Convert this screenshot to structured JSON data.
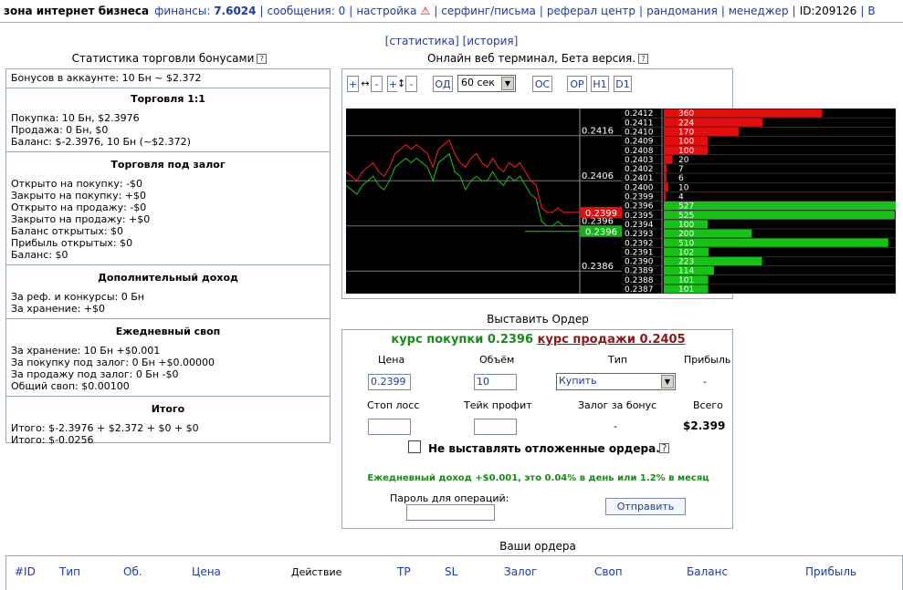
{
  "topbar": {
    "brand": "зона интернет бизнеса",
    "finance_label": "финансы:",
    "finance_value": "7.6024",
    "messages": "сообщения: 0",
    "settings": "настройка",
    "surfing": "серфинг/письма",
    "referral": "реферал центр",
    "randomania": "рандомания",
    "manager": "менеджер",
    "user_id": "ID:209126",
    "extra": "В"
  },
  "top_links": {
    "stats": "[статистика]",
    "history": "[история]"
  },
  "left": {
    "title": "Статистика торговли бонусами",
    "bonus_line": "Бонусов в аккаунте: 10 Бн ~ $2.372",
    "sections": [
      {
        "title": "Торговля 1:1",
        "lines": [
          "Покупка: 10 Бн, $2.3976",
          "Продажа: 0 Бн, $0",
          "Баланс: $-2.3976, 10 Бн (~$2.372)"
        ]
      },
      {
        "title": "Торговля под залог",
        "lines": [
          "Открыто на покупку: -$0",
          "Закрыто на покупку: +$0",
          "Открыто на продажу: -$0",
          "Закрыто на продажу: +$0",
          "Баланс открытых: $0",
          "Прибыль открытых: $0",
          "Баланс: $0"
        ]
      },
      {
        "title": "Дополнительный доход",
        "lines": [
          "За реф. и конкурсы: 0 Бн",
          "За хранение: +$0"
        ]
      },
      {
        "title": "Ежедневный своп",
        "lines": [
          "За хранение: 10 Бн +$0.001",
          "За покупку под залог: 0 Бн +$0.00000",
          "За продажу под залог: 0 Бн -$0",
          "Общий своп: $0.00100"
        ]
      },
      {
        "title": "Итого",
        "lines": [
          "Итого: $-2.3976 + $2.372 + $0 + $0",
          "Итого: $-0.0256"
        ]
      }
    ]
  },
  "terminal": {
    "title": "Онлайн веб терминал, Бета версия.",
    "toolbar": {
      "zoom_in_h": "+↔",
      "zoom_out_h": "-",
      "zoom_in_v": "+↕",
      "zoom_out_v": "-",
      "od": "ОД",
      "interval": "60 сек",
      "os": "ОС",
      "op": "ОР",
      "h1": "H1",
      "d1": "D1"
    }
  },
  "chart_data": {
    "type": "line",
    "y_ticks": [
      "0.2416",
      "0.2406",
      "0.2396",
      "0.2386"
    ],
    "ylim": [
      0.2381,
      0.2422
    ],
    "ask_label": "0.2399",
    "bid_label": "0.2396",
    "series": [
      {
        "color": "#ff2020",
        "values": [
          0.2408,
          0.2407,
          0.2406,
          0.2408,
          0.2409,
          0.241,
          0.2408,
          0.2407,
          0.2409,
          0.2412,
          0.2413,
          0.2414,
          0.2413,
          0.2414,
          0.2413,
          0.2412,
          0.2409,
          0.2413,
          0.2414,
          0.2415,
          0.2412,
          0.241,
          0.2409,
          0.2411,
          0.2412,
          0.241,
          0.2409,
          0.2411,
          0.2409,
          0.2408,
          0.241,
          0.2409,
          0.241,
          0.2408,
          0.2406,
          0.2405,
          0.24,
          0.2399,
          0.2399,
          0.24,
          0.2399,
          0.2399
        ]
      },
      {
        "color": "#20c020",
        "values": [
          0.2405,
          0.2404,
          0.2403,
          0.2405,
          0.2406,
          0.2407,
          0.2405,
          0.2404,
          0.2406,
          0.2409,
          0.241,
          0.2411,
          0.241,
          0.2411,
          0.241,
          0.2409,
          0.2406,
          0.241,
          0.2411,
          0.2412,
          0.2408,
          0.2407,
          0.2404,
          0.2406,
          0.2407,
          0.2406,
          0.2406,
          0.2408,
          0.2406,
          0.2405,
          0.2407,
          0.2406,
          0.2407,
          0.2405,
          0.2403,
          0.2402,
          0.2397,
          0.2396,
          0.2396,
          0.2397,
          0.2396,
          0.2396
        ]
      }
    ],
    "order_book": {
      "asks": [
        [
          0.2412,
          360
        ],
        [
          0.2411,
          224
        ],
        [
          0.241,
          170
        ],
        [
          0.2409,
          100
        ],
        [
          0.2408,
          100
        ],
        [
          0.2403,
          20
        ],
        [
          0.2402,
          7
        ],
        [
          0.2401,
          6
        ],
        [
          0.24,
          10
        ],
        [
          0.2399,
          4
        ]
      ],
      "bids": [
        [
          0.2396,
          527
        ],
        [
          0.2395,
          525
        ],
        [
          0.2394,
          100
        ],
        [
          0.2393,
          200
        ],
        [
          0.2392,
          510
        ],
        [
          0.2391,
          102
        ],
        [
          0.239,
          223
        ],
        [
          0.2389,
          114
        ],
        [
          0.2388,
          101
        ],
        [
          0.2387,
          101
        ]
      ],
      "max_volume": 527,
      "ask_color": "#e01010",
      "bid_color": "#18c018"
    }
  },
  "order": {
    "title": "Выставить Ордер",
    "buy_rate": "курс покупки 0.2396",
    "sell_rate": "курс продажи 0.2405",
    "headers": {
      "price": "Цена",
      "volume": "Объём",
      "type": "Тип",
      "profit": "Прибыль",
      "stop_loss": "Стоп лосс",
      "take_profit": "Тейк профит",
      "collateral": "Залог за бонус",
      "total": "Всего"
    },
    "price_value": "0.2399",
    "volume_value": "10",
    "type_value": "Купить",
    "profit_value": "-",
    "collateral_value": "-",
    "total_value": "$2.399",
    "checkbox_label": "Не выставлять отложенные ордера.",
    "daily_income": "Ежедневный доход +$0.001, это 0.04% в день или 1.2% в месяц",
    "password_label": "Пароль для операций:",
    "submit": "Отправить"
  },
  "orders": {
    "title": "Ваши ордера",
    "columns": [
      "#ID",
      "Тип",
      "Об.",
      "Цена",
      "Действие",
      "TP",
      "SL",
      "Залог",
      "Своп",
      "Баланс",
      "Прибыль"
    ]
  }
}
